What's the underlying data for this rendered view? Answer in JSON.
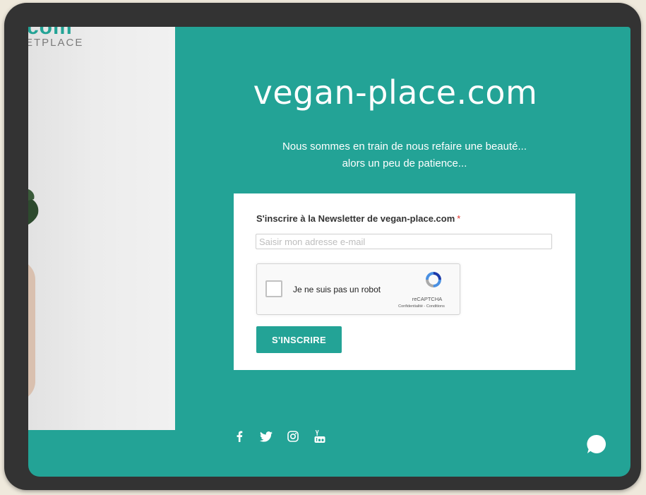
{
  "brand": {
    "logo_partial": "com",
    "logo_sub_partial": "ETPLACE"
  },
  "hero": {
    "title": "vegan-place.com",
    "tagline_line1": "Nous sommes en train de nous refaire une beauté...",
    "tagline_line2": "alors un peu de patience..."
  },
  "newsletter": {
    "label": "S'inscrire à la Newsletter de vegan-place.com",
    "required_mark": "*",
    "email_placeholder": "Saisir mon adresse e-mail",
    "email_value": "",
    "captcha": {
      "checkbox_label": "Je ne suis pas un robot",
      "brand": "reCAPTCHA",
      "links": "Confidentialité - Conditions",
      "checked": false
    },
    "submit_label": "S'INSCRIRE"
  },
  "social": {
    "icons": [
      "facebook-icon",
      "twitter-icon",
      "instagram-icon",
      "youtube-icon"
    ]
  },
  "colors": {
    "accent": "#23a396",
    "background_frame": "#333333",
    "page_bg": "#efe9dc",
    "required": "#e0322a"
  }
}
